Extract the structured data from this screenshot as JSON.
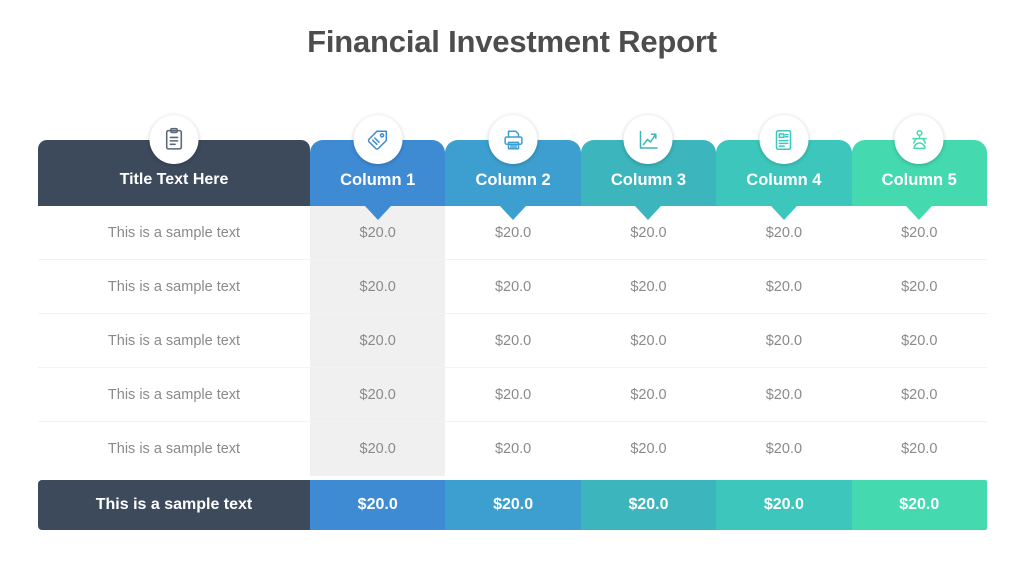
{
  "slide": {
    "title": "Financial Investment Report",
    "background": "#ffffff",
    "title_color": "#4d4d4d"
  },
  "theme": {
    "label_color": "#3d4a5c",
    "body_text_color": "#8a8a8a",
    "col1_band_color": "#f0f0f0",
    "divider_color": "#f3f3f3",
    "badge_bg": "#ffffff"
  },
  "table": {
    "header": {
      "label": "Title Text Here",
      "label_icon": "clipboard-icon",
      "columns": [
        {
          "label": "Column 1",
          "icon": "tag-icon",
          "color": "#3e8bd4"
        },
        {
          "label": "Column 2",
          "icon": "printer-icon",
          "color": "#3d9fd0"
        },
        {
          "label": "Column 3",
          "icon": "line-chart-icon",
          "color": "#3cb5bc"
        },
        {
          "label": "Column 4",
          "icon": "document-icon",
          "color": "#3dc7bc"
        },
        {
          "label": "Column 5",
          "icon": "presenter-icon",
          "color": "#44d9ae"
        }
      ]
    },
    "rows": [
      {
        "label": "This is a sample text",
        "values": [
          "$20.0",
          "$20.0",
          "$20.0",
          "$20.0",
          "$20.0"
        ]
      },
      {
        "label": "This is a sample text",
        "values": [
          "$20.0",
          "$20.0",
          "$20.0",
          "$20.0",
          "$20.0"
        ]
      },
      {
        "label": "This is a sample text",
        "values": [
          "$20.0",
          "$20.0",
          "$20.0",
          "$20.0",
          "$20.0"
        ]
      },
      {
        "label": "This is a sample text",
        "values": [
          "$20.0",
          "$20.0",
          "$20.0",
          "$20.0",
          "$20.0"
        ]
      },
      {
        "label": "This is a sample text",
        "values": [
          "$20.0",
          "$20.0",
          "$20.0",
          "$20.0",
          "$20.0"
        ]
      }
    ],
    "footer": {
      "label": "This is a sample text",
      "values": [
        "$20.0",
        "$20.0",
        "$20.0",
        "$20.0",
        "$20.0"
      ]
    }
  }
}
